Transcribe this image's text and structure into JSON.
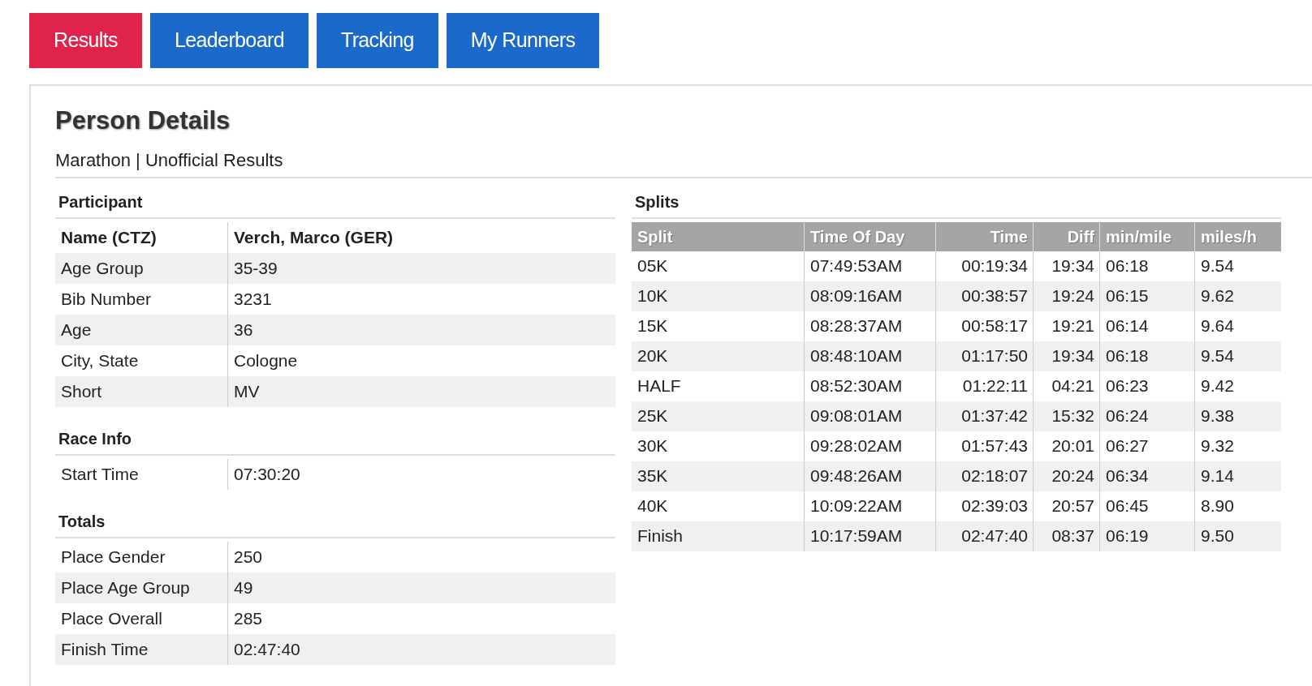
{
  "tabs": [
    {
      "label": "Results",
      "selected": true
    },
    {
      "label": "Leaderboard",
      "selected": false
    },
    {
      "label": "Tracking",
      "selected": false
    },
    {
      "label": "My Runners",
      "selected": false
    }
  ],
  "panel": {
    "title": "Person Details",
    "subtitle": "Marathon | Unofficial Results"
  },
  "sections": [
    {
      "title": "Participant",
      "rows": [
        {
          "kind": "heading",
          "label": "Name (CTZ)",
          "value": "Verch, Marco (GER)"
        },
        {
          "kind": "plain",
          "label": "Age Group",
          "value": "35-39"
        },
        {
          "kind": "plain",
          "label": "Bib Number",
          "value": "3231"
        },
        {
          "kind": "plain",
          "label": "Age",
          "value": "36"
        },
        {
          "kind": "plain",
          "label": "City, State",
          "value": "Cologne"
        },
        {
          "kind": "plain",
          "label": "Short",
          "value": "MV"
        }
      ]
    },
    {
      "title": "Race Info",
      "rows": [
        {
          "kind": "plain",
          "label": "Start Time",
          "value": "07:30:20"
        }
      ]
    },
    {
      "title": "Totals",
      "rows": [
        {
          "kind": "plain",
          "label": "Place Gender",
          "value": "250"
        },
        {
          "kind": "plain",
          "label": "Place Age Group",
          "value": "49"
        },
        {
          "kind": "plain",
          "label": "Place Overall",
          "value": "285"
        },
        {
          "kind": "plain",
          "label": "Finish Time",
          "value": "02:47:40"
        }
      ]
    }
  ],
  "splits": {
    "title": "Splits",
    "columns": [
      {
        "label": "Split",
        "kind": "text"
      },
      {
        "label": "Time Of Day",
        "kind": "text"
      },
      {
        "label": "Time",
        "kind": "number"
      },
      {
        "label": "Diff",
        "kind": "number"
      },
      {
        "label": "min/mile",
        "kind": "text"
      },
      {
        "label": "miles/h",
        "kind": "text"
      }
    ],
    "rows": [
      [
        "05K",
        "07:49:53AM",
        "00:19:34",
        "19:34",
        "06:18",
        "9.54"
      ],
      [
        "10K",
        "08:09:16AM",
        "00:38:57",
        "19:24",
        "06:15",
        "9.62"
      ],
      [
        "15K",
        "08:28:37AM",
        "00:58:17",
        "19:21",
        "06:14",
        "9.64"
      ],
      [
        "20K",
        "08:48:10AM",
        "01:17:50",
        "19:34",
        "06:18",
        "9.54"
      ],
      [
        "HALF",
        "08:52:30AM",
        "01:22:11",
        "04:21",
        "06:23",
        "9.42"
      ],
      [
        "25K",
        "09:08:01AM",
        "01:37:42",
        "15:32",
        "06:24",
        "9.38"
      ],
      [
        "30K",
        "09:28:02AM",
        "01:57:43",
        "20:01",
        "06:27",
        "9.32"
      ],
      [
        "35K",
        "09:48:26AM",
        "02:18:07",
        "20:24",
        "06:34",
        "9.14"
      ],
      [
        "40K",
        "10:09:22AM",
        "02:39:03",
        "20:57",
        "06:45",
        "8.90"
      ],
      [
        "Finish",
        "10:17:59AM",
        "02:47:40",
        "08:37",
        "06:19",
        "9.50"
      ]
    ]
  }
}
